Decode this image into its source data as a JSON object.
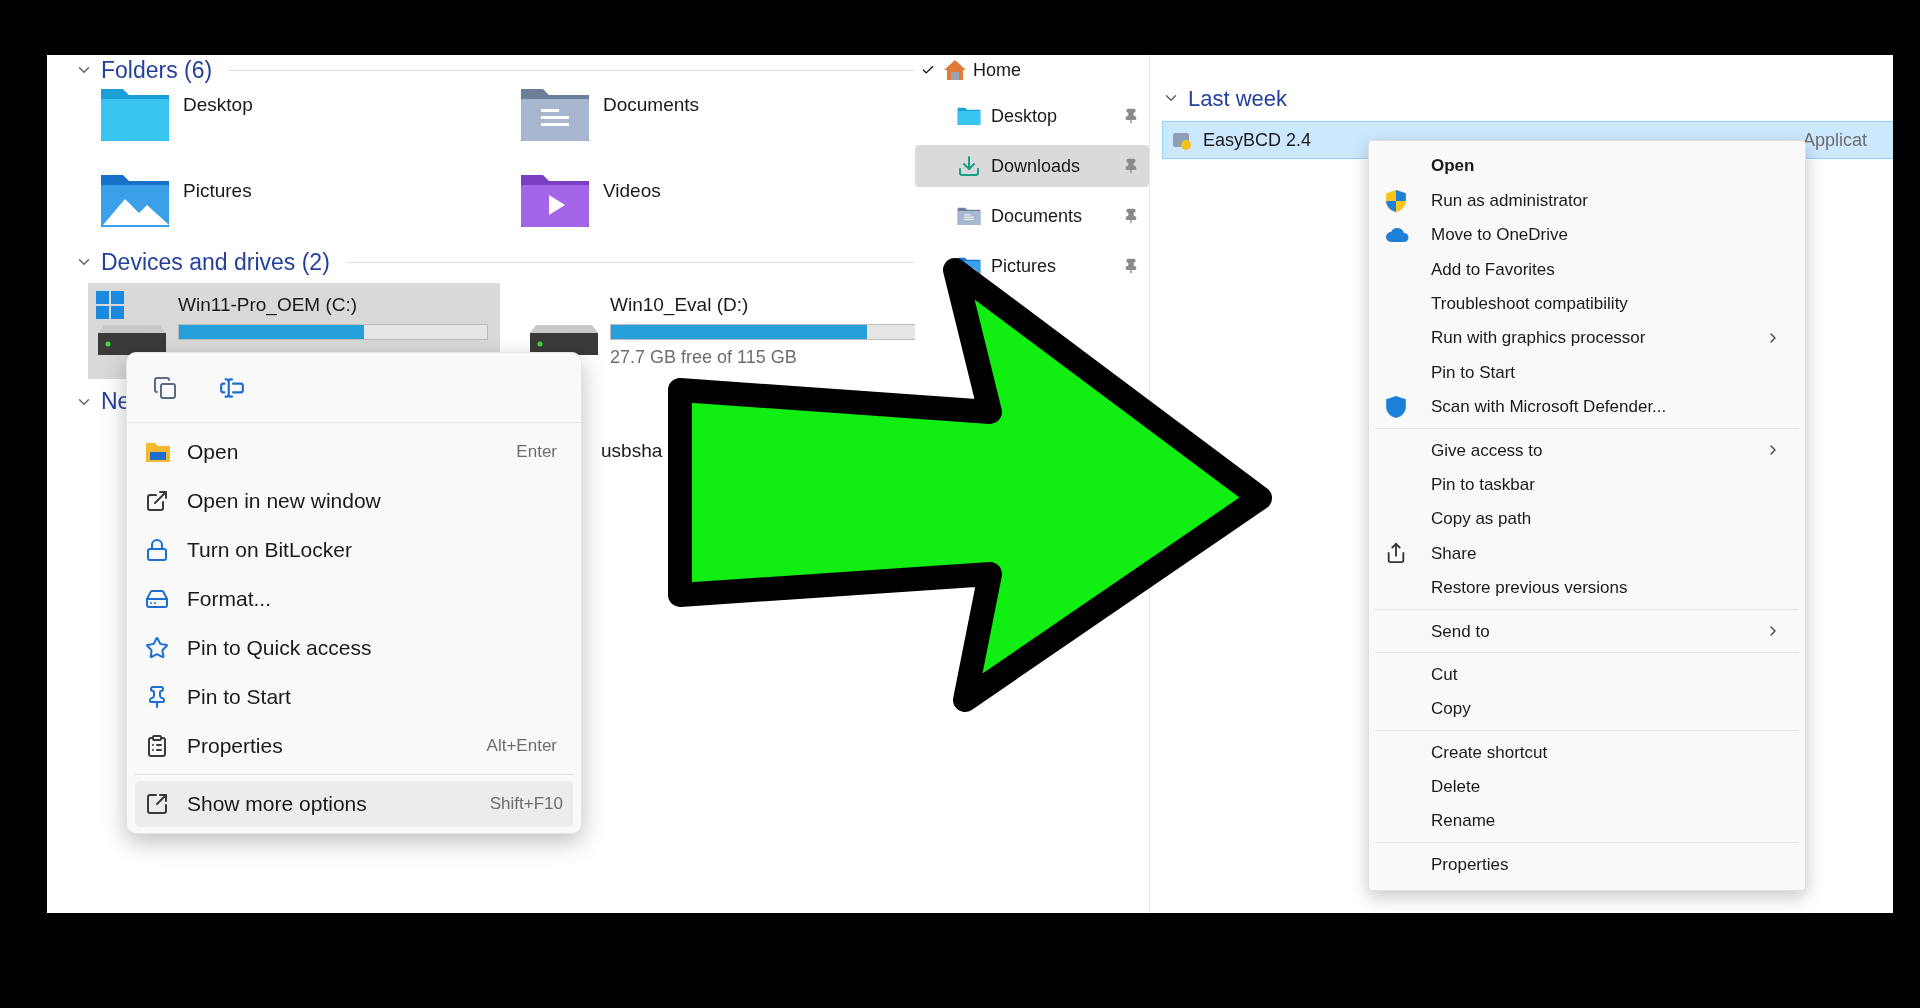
{
  "folders_section": {
    "title": "Folders (6)",
    "items": [
      {
        "name": "Desktop",
        "kind": "desktop"
      },
      {
        "name": "Documents",
        "kind": "documents"
      },
      {
        "name": "Pictures",
        "kind": "pictures"
      },
      {
        "name": "Videos",
        "kind": "videos"
      }
    ]
  },
  "drives_section": {
    "title": "Devices and drives (2)",
    "drives": [
      {
        "name": "Win11-Pro_OEM (C:)",
        "kind": "system",
        "selected": true,
        "level": 0.6
      },
      {
        "name": "Win10_Eval (D:)",
        "kind": "disk",
        "selected": false,
        "level": 0.83,
        "free": "27.7 GB free of 115 GB"
      }
    ]
  },
  "network_section": {
    "title": "Ne",
    "items": [
      {
        "name": "usbsha"
      }
    ]
  },
  "drive_menu": {
    "items": [
      {
        "label": "Open",
        "shortcut": "Enter",
        "selected": false
      },
      {
        "label": "Open in new window",
        "selected": false
      },
      {
        "label": "Turn on BitLocker",
        "selected": false
      },
      {
        "label": "Format...",
        "selected": false
      },
      {
        "label": "Pin to Quick access",
        "selected": false
      },
      {
        "label": "Pin to Start",
        "selected": false
      },
      {
        "label": "Properties",
        "shortcut": "Alt+Enter",
        "selected": false
      }
    ],
    "footer_items": [
      {
        "label": "Show more options",
        "shortcut": "Shift+F10",
        "selected": true
      }
    ]
  },
  "nav_pane": {
    "home": {
      "label": "Home",
      "checked": true
    },
    "items": [
      {
        "label": "Desktop",
        "kind": "desktop",
        "selected": false,
        "pinned": true
      },
      {
        "label": "Downloads",
        "kind": "downloads",
        "selected": true,
        "pinned": true
      },
      {
        "label": "Documents",
        "kind": "documents",
        "selected": false,
        "pinned": true
      },
      {
        "label": "Pictures",
        "kind": "pictures",
        "selected": false,
        "pinned": true
      }
    ]
  },
  "recent": {
    "title": "Last week",
    "files": [
      {
        "name": "EasyBCD 2.4",
        "type": "Applicat",
        "selected": true
      }
    ]
  },
  "file_menu": {
    "groups": [
      [
        {
          "label": "Open",
          "default": true,
          "submenu": false
        },
        {
          "label": "Run as administrator",
          "default": false,
          "submenu": false
        },
        {
          "label": "Move to OneDrive",
          "default": false,
          "submenu": false
        },
        {
          "label": "Add to Favorites",
          "default": false,
          "submenu": false
        },
        {
          "label": "Troubleshoot compatibility",
          "default": false,
          "submenu": false
        },
        {
          "label": "Run with graphics processor",
          "default": false,
          "submenu": true
        },
        {
          "label": "Pin to Start",
          "default": false,
          "submenu": false
        },
        {
          "label": "Scan with Microsoft Defender...",
          "default": false,
          "submenu": false
        }
      ],
      [
        {
          "label": "Give access to",
          "default": false,
          "submenu": true
        },
        {
          "label": "Pin to taskbar",
          "default": false,
          "submenu": false
        },
        {
          "label": "Copy as path",
          "default": false,
          "submenu": false
        },
        {
          "label": "Share",
          "default": false,
          "submenu": false
        },
        {
          "label": "Restore previous versions",
          "default": false,
          "submenu": false
        }
      ],
      [
        {
          "label": "Send to",
          "default": false,
          "submenu": true
        }
      ],
      [
        {
          "label": "Cut",
          "default": false,
          "submenu": false
        },
        {
          "label": "Copy",
          "default": false,
          "submenu": false
        }
      ],
      [
        {
          "label": "Create shortcut",
          "default": false,
          "submenu": false
        },
        {
          "label": "Delete",
          "default": false,
          "submenu": false
        },
        {
          "label": "Rename",
          "default": false,
          "submenu": false
        }
      ],
      [
        {
          "label": "Properties",
          "default": false,
          "submenu": false
        }
      ]
    ]
  }
}
